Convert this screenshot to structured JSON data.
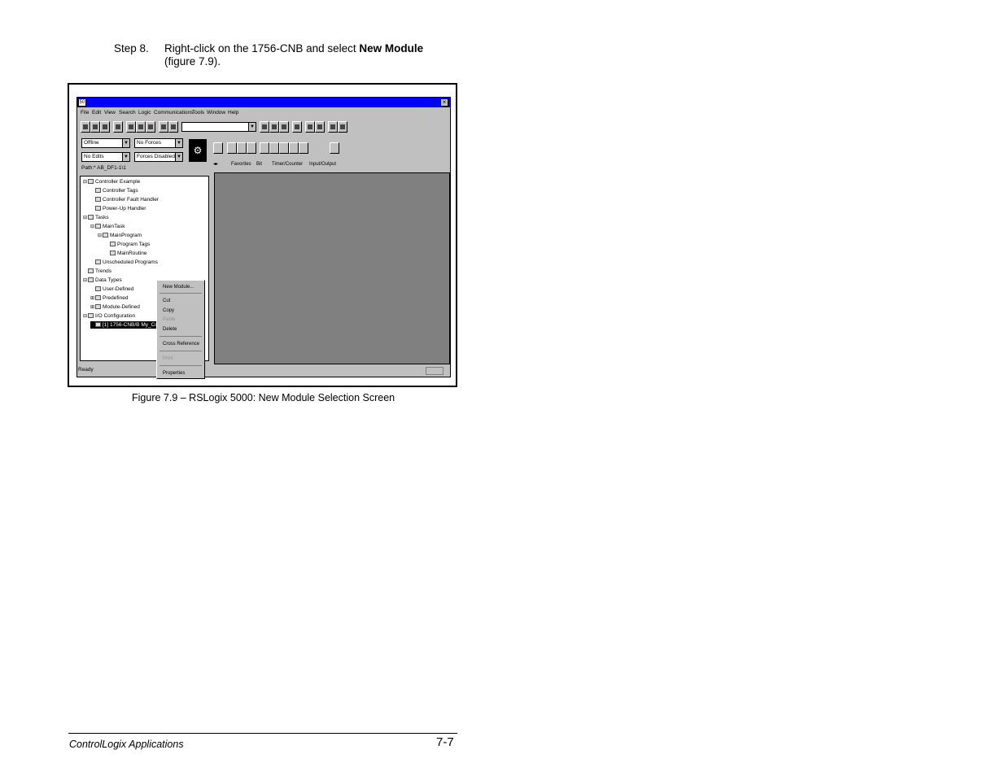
{
  "step": {
    "number": "Step 8.",
    "text_before": "Right-click on the 1756-CNB and select ",
    "text_bold": "New Module",
    "text_after": "(figure 7.9)."
  },
  "figure_caption": "Figure 7.9 – RSLogix 5000: New Module Selection Screen",
  "footer": {
    "left": "ControlLogix Applications",
    "right": "7-7"
  },
  "app": {
    "title_icon": "50",
    "menu": [
      "File",
      "Edit",
      "View",
      "Search",
      "Logic",
      "Communications",
      "Tools",
      "Window",
      "Help"
    ],
    "mode_select": "Offline",
    "forces_select": "No Forces",
    "edits_select": "No Edits",
    "forces_state_select": "Forces Disabled",
    "path": "Path:* AB_DF1-1\\1",
    "tabs": [
      "Favorites",
      "Bit",
      "Timer/Counter",
      "Input/Output"
    ],
    "tree": [
      {
        "label": "Controller Example",
        "level": 0,
        "pm": "⊟"
      },
      {
        "label": "Controller Tags",
        "level": 1,
        "pm": ""
      },
      {
        "label": "Controller Fault Handler",
        "level": 1,
        "pm": ""
      },
      {
        "label": "Power-Up Handler",
        "level": 1,
        "pm": ""
      },
      {
        "label": "Tasks",
        "level": 0,
        "pm": "⊟"
      },
      {
        "label": "MainTask",
        "level": 1,
        "pm": "⊟"
      },
      {
        "label": "MainProgram",
        "level": 2,
        "pm": "⊟"
      },
      {
        "label": "Program Tags",
        "level": 3,
        "pm": ""
      },
      {
        "label": "MainRoutine",
        "level": 3,
        "pm": ""
      },
      {
        "label": "Unscheduled Programs",
        "level": 1,
        "pm": ""
      },
      {
        "label": "Trends",
        "level": 0,
        "pm": ""
      },
      {
        "label": "Data Types",
        "level": 0,
        "pm": "⊟"
      },
      {
        "label": "User-Defined",
        "level": 1,
        "pm": ""
      },
      {
        "label": "Predefined",
        "level": 1,
        "pm": "⊞"
      },
      {
        "label": "Module-Defined",
        "level": 1,
        "pm": "⊞"
      },
      {
        "label": "I/O Configuration",
        "level": 0,
        "pm": "⊟"
      },
      {
        "label": "[1] 1756-CNB/B My_Cont",
        "level": 1,
        "pm": "",
        "selected": true
      }
    ],
    "context_menu": {
      "new_module": "New Module...",
      "cut": "Cut",
      "copy": "Copy",
      "paste": "Paste",
      "delete": "Delete",
      "cross_reference": "Cross Reference",
      "print": "Print",
      "properties": "Properties"
    },
    "status": "Ready"
  }
}
